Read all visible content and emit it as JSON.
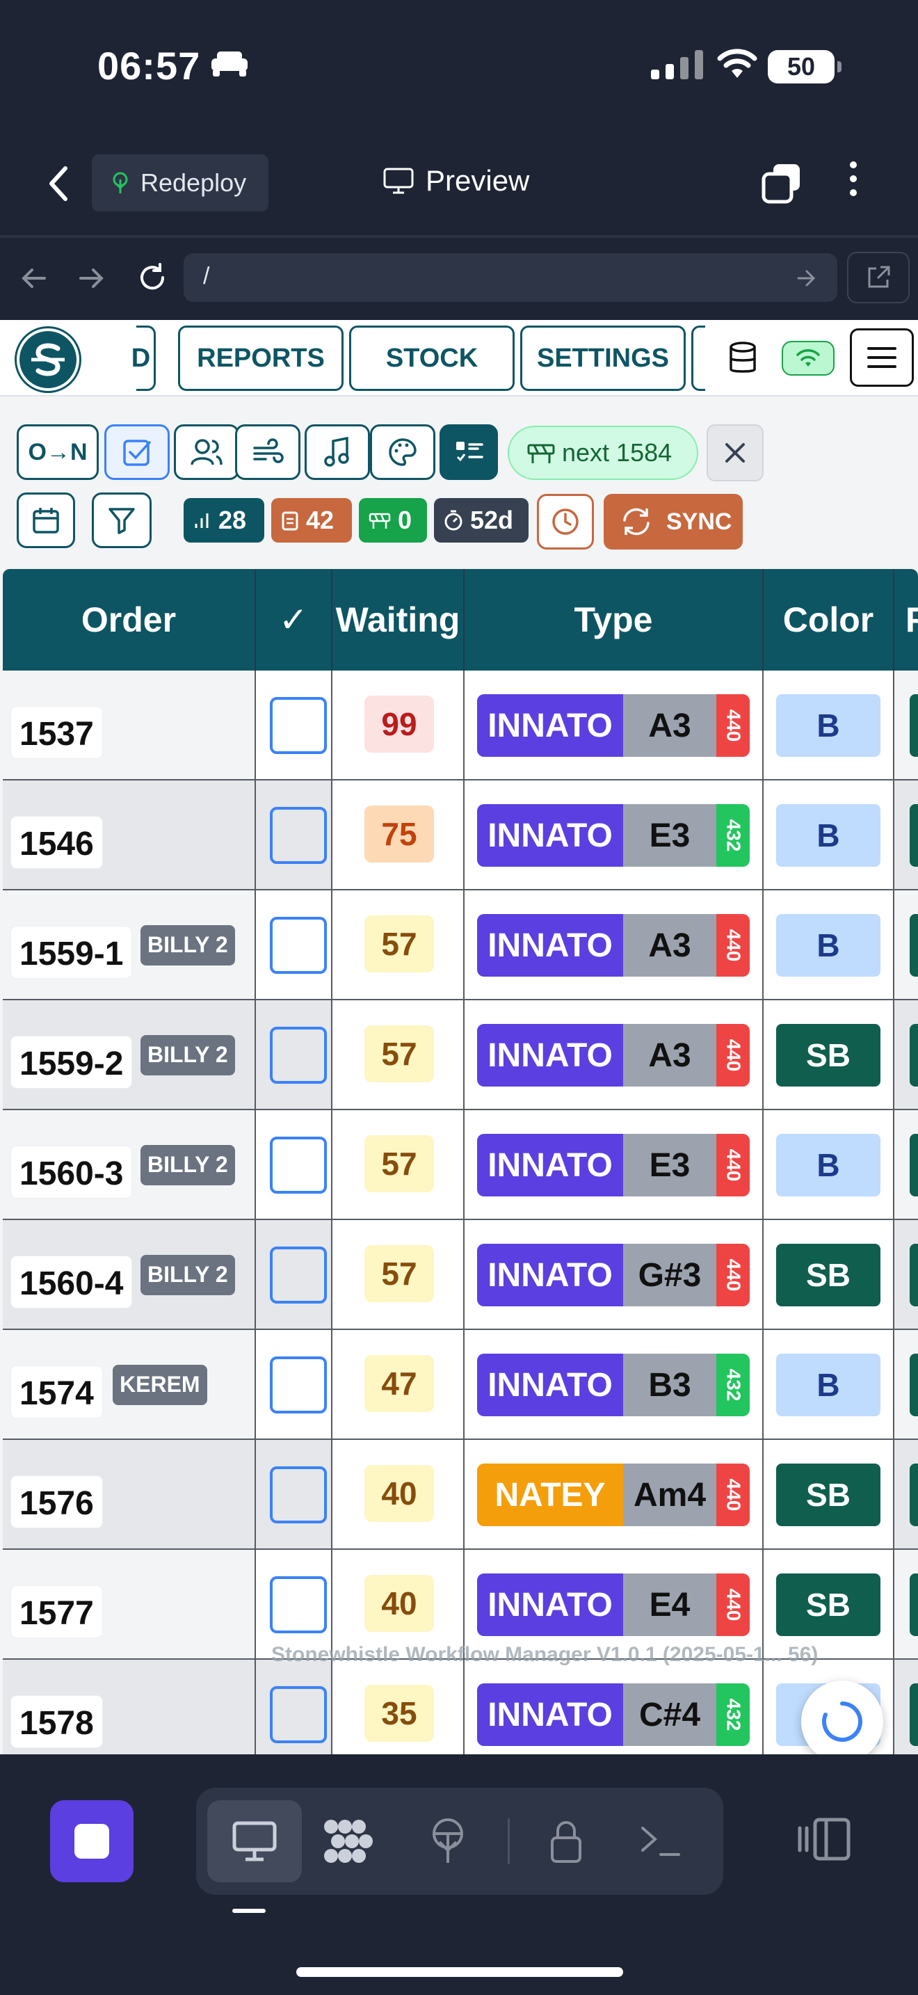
{
  "status_bar": {
    "time": "06:57",
    "battery": "50"
  },
  "topbar": {
    "redeploy_label": "Redeploy",
    "preview_label": "Preview"
  },
  "urlbar": {
    "url": "/"
  },
  "app_nav": {
    "partial_tab": "D",
    "tabs": [
      "REPORTS",
      "STOCK",
      "SETTINGS"
    ]
  },
  "toolbar": {
    "sort_label": "O→N",
    "next_label": "next 1584",
    "sync_label": "SYNC",
    "stats": [
      {
        "name": "bar-chart-icon",
        "value": "28",
        "color": "#0e5563"
      },
      {
        "name": "clipboard-icon",
        "value": "42",
        "color": "#c7683f"
      },
      {
        "name": "construction-icon",
        "value": "0",
        "color": "#16a34a"
      },
      {
        "name": "timer-icon",
        "value": "52d",
        "color": "#374151"
      }
    ]
  },
  "table": {
    "headers": [
      "Order",
      "✓",
      "Waiting",
      "Type",
      "Color",
      "F"
    ],
    "rows": [
      {
        "order": "1537",
        "tag": "",
        "waiting": "99",
        "brand": "INNATO",
        "key": "A3",
        "freq": "440",
        "color": "B"
      },
      {
        "order": "1546",
        "tag": "",
        "waiting": "75",
        "brand": "INNATO",
        "key": "E3",
        "freq": "432",
        "color": "B"
      },
      {
        "order": "1559-1",
        "tag": "BILLY 2",
        "waiting": "57",
        "brand": "INNATO",
        "key": "A3",
        "freq": "440",
        "color": "B"
      },
      {
        "order": "1559-2",
        "tag": "BILLY 2",
        "waiting": "57",
        "brand": "INNATO",
        "key": "A3",
        "freq": "440",
        "color": "SB"
      },
      {
        "order": "1560-3",
        "tag": "BILLY 2",
        "waiting": "57",
        "brand": "INNATO",
        "key": "E3",
        "freq": "440",
        "color": "B"
      },
      {
        "order": "1560-4",
        "tag": "BILLY 2",
        "waiting": "57",
        "brand": "INNATO",
        "key": "G#3",
        "freq": "440",
        "color": "SB"
      },
      {
        "order": "1574",
        "tag": "KEREM",
        "waiting": "47",
        "brand": "INNATO",
        "key": "B3",
        "freq": "432",
        "color": "B"
      },
      {
        "order": "1576",
        "tag": "",
        "waiting": "40",
        "brand": "NATEY",
        "key": "Am4",
        "freq": "440",
        "color": "SB"
      },
      {
        "order": "1577",
        "tag": "",
        "waiting": "40",
        "brand": "INNATO",
        "key": "E4",
        "freq": "440",
        "color": "SB"
      },
      {
        "order": "1578",
        "tag": "",
        "waiting": "35",
        "brand": "INNATO",
        "key": "C#4",
        "freq": "432",
        "color": "B"
      }
    ]
  },
  "footer": {
    "text": "Stonewhistle Workflow Manager V1.0.1 (2025-05-1... 56)"
  },
  "colors": {
    "teal": "#0e5563",
    "innato": "#5b3fe0",
    "natey": "#f59e0b",
    "freq440": "#ef4444",
    "freq432": "#22c55e",
    "color_b": "#bfdbfe",
    "color_sb": "#0f5e4e"
  }
}
